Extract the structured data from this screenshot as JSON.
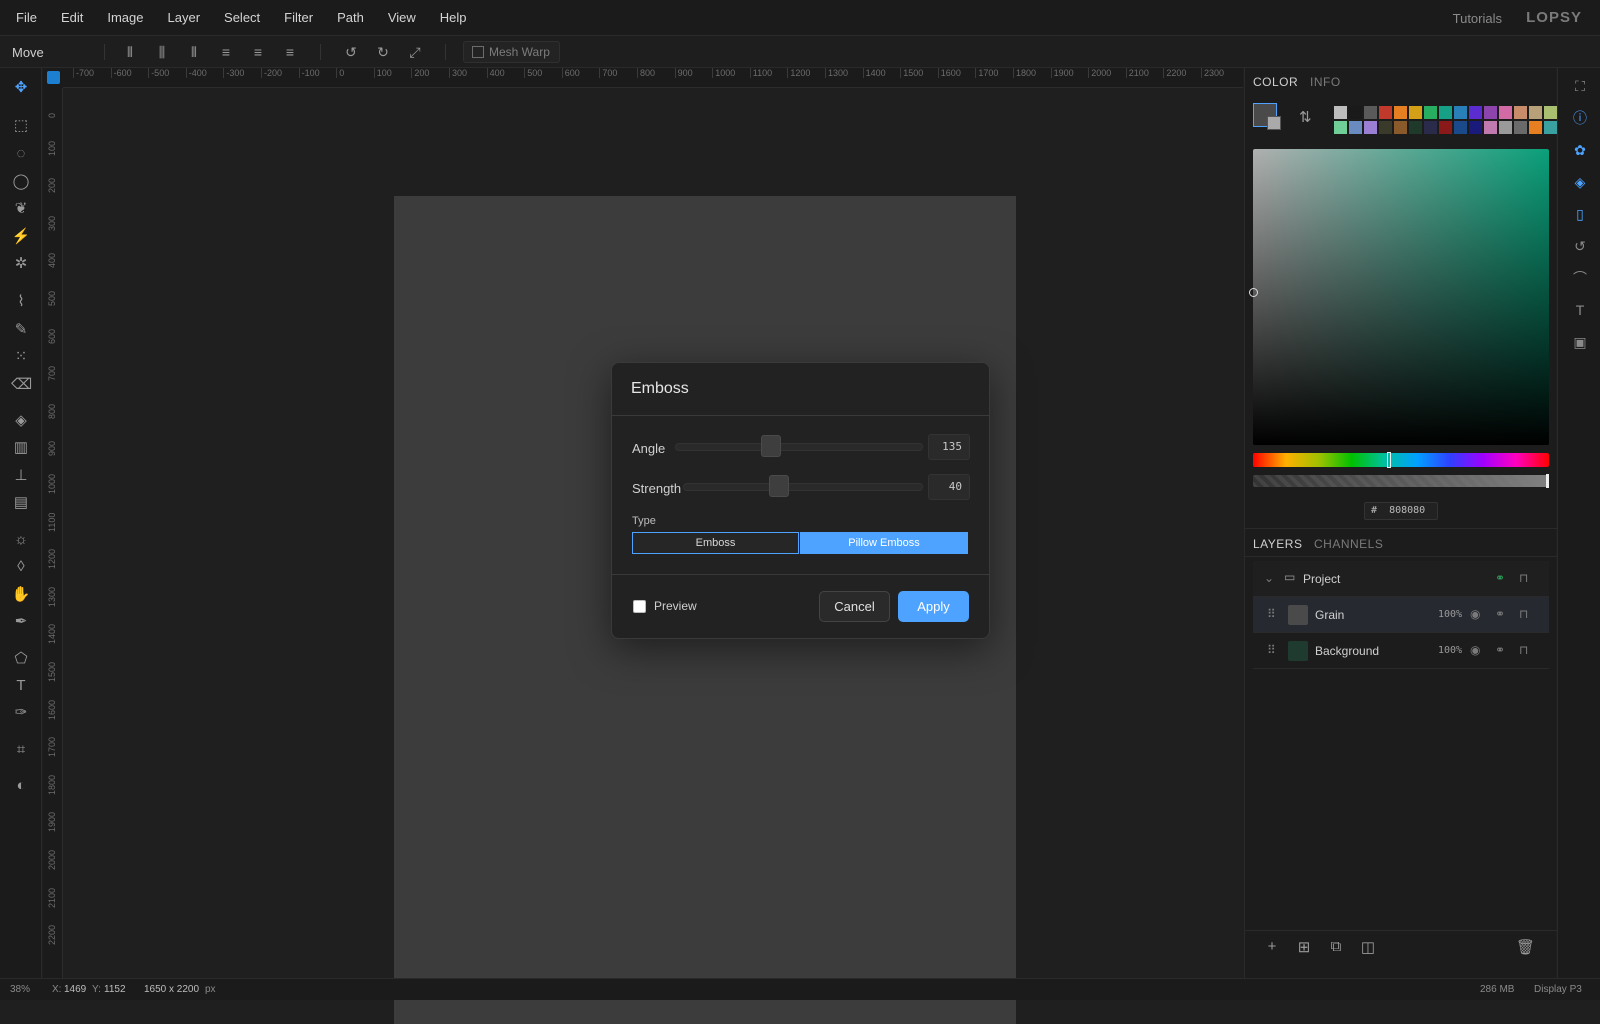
{
  "menubar": {
    "items": [
      "File",
      "Edit",
      "Image",
      "Layer",
      "Select",
      "Filter",
      "Path",
      "View",
      "Help"
    ],
    "tutorials": "Tutorials",
    "logo": "LOPSY"
  },
  "optionsbar": {
    "tool_name": "Move",
    "mesh_warp": "Mesh Warp"
  },
  "rulers": {
    "horizontal_ticks": [
      "-700",
      "-600",
      "-500",
      "-400",
      "-300",
      "-200",
      "-100",
      "0",
      "100",
      "200",
      "300",
      "400",
      "500",
      "600",
      "700",
      "800",
      "900",
      "1000",
      "1100",
      "1200",
      "1300",
      "1400",
      "1500",
      "1600",
      "1700",
      "1800",
      "1900",
      "2000",
      "2100",
      "2200",
      "2300"
    ],
    "vertical_ticks": [
      "0",
      "100",
      "200",
      "300",
      "400",
      "500",
      "600",
      "700",
      "800",
      "900",
      "1000",
      "1100",
      "1200",
      "1300",
      "1400",
      "1500",
      "1600",
      "1700",
      "1800",
      "1900",
      "2000",
      "2100",
      "2200"
    ]
  },
  "dialog": {
    "title": "Emboss",
    "angle_label": "Angle",
    "angle_value": "135",
    "strength_label": "Strength",
    "strength_value": "40",
    "type_label": "Type",
    "type_options": [
      "Emboss",
      "Pillow Emboss"
    ],
    "type_selected": "Pillow Emboss",
    "preview_label": "Preview",
    "preview_checked": false,
    "cancel_label": "Cancel",
    "apply_label": "Apply"
  },
  "panel": {
    "color_tab": "COLOR",
    "info_tab": "INFO",
    "hex_prefix": "#",
    "hex_value": "808080",
    "layers_tab": "LAYERS",
    "channels_tab": "CHANNELS",
    "group_name": "Project",
    "layers": [
      {
        "name": "Grain",
        "opacity": "100%",
        "thumb_color": "#4a4a4a"
      },
      {
        "name": "Background",
        "opacity": "100%",
        "thumb_color": "#1f3a2e"
      }
    ]
  },
  "swatches": [
    "#bdbdbd",
    "#1a1a1a",
    "#5a5a5a",
    "#c0392b",
    "#e67e22",
    "#d4a017",
    "#27ae60",
    "#16a085",
    "#2980b9",
    "#5b2ccf",
    "#8e44ad",
    "#d16aa5",
    "#c98c6b",
    "#b8a078",
    "#a8c070",
    "#6fcf97",
    "#6a8bbf",
    "#9b7fd4",
    "#3a3a2a",
    "#8a5a2a",
    "#1f3a2a",
    "#2a2a4a",
    "#8a1a1a",
    "#1a4a8a",
    "#1a1a7a",
    "#c07ab0",
    "#9a9a9a",
    "#6a6a6a",
    "#e67e22",
    "#3aa0a0"
  ],
  "statusbar": {
    "zoom": "38%",
    "cursor_x_label": "X:",
    "cursor_x": "1469",
    "cursor_y_label": "Y:",
    "cursor_y": "1152",
    "doc_size": "1650 x 2200",
    "doc_unit": "px",
    "memory": "286 MB",
    "display": "Display P3"
  },
  "colors": {
    "accent": "#4da3ff",
    "canvas_doc": "#3c3c3c",
    "foreground": "#808080"
  }
}
